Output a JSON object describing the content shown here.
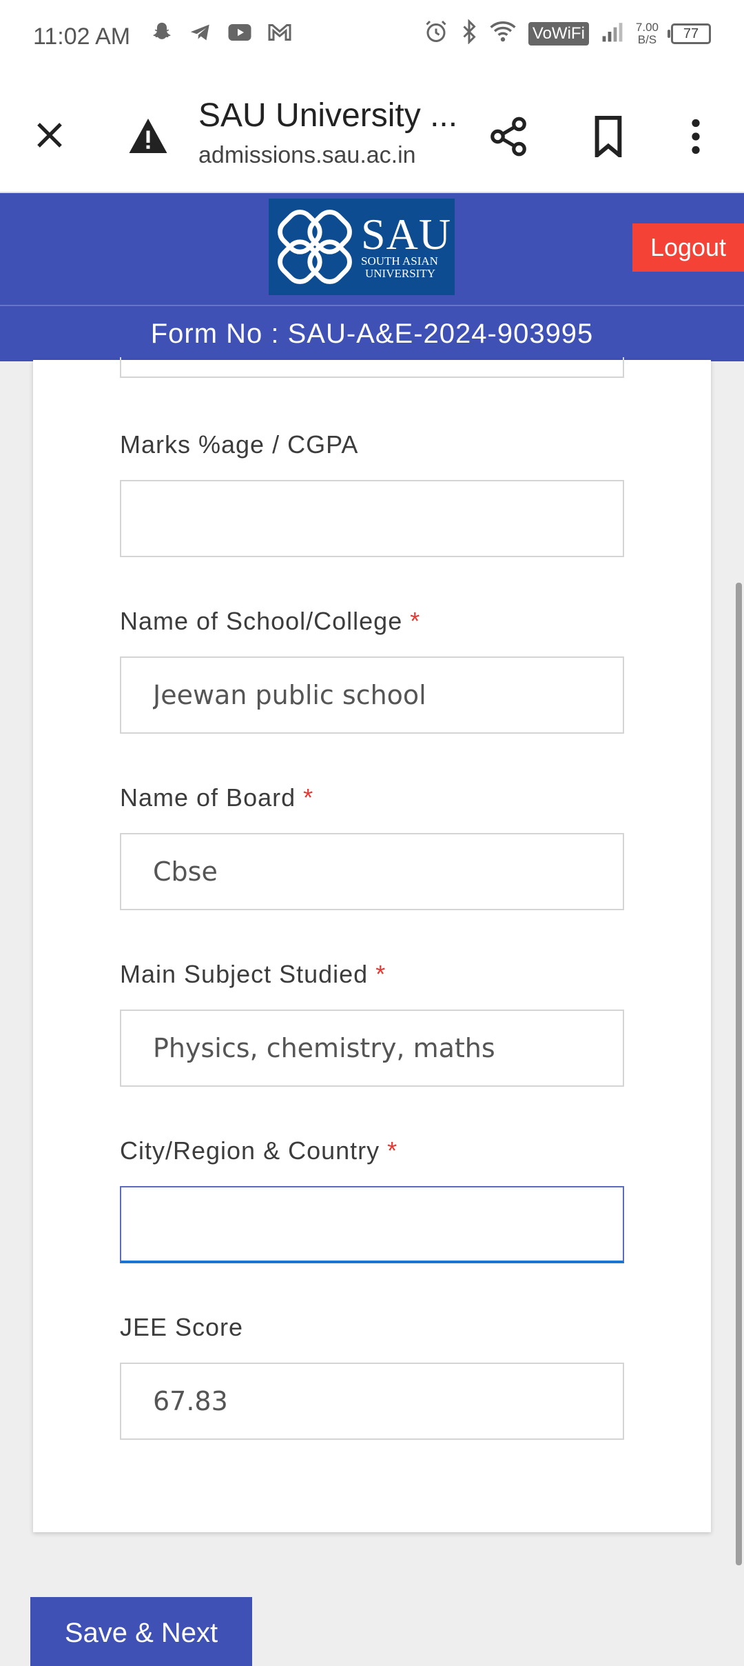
{
  "status_bar": {
    "time": "11:02 AM",
    "left_icons": [
      "snapchat-icon",
      "telegram-icon",
      "youtube-icon",
      "gmail-icon"
    ],
    "right_icons": [
      "alarm-icon",
      "bluetooth-icon",
      "wifi-icon",
      "vowifi-badge",
      "signal-icon",
      "net-speed",
      "battery-icon"
    ],
    "vowifi": "VoWiFi",
    "net_speed_value": "7.00",
    "net_speed_unit": "B/S",
    "battery_level": "77"
  },
  "browser": {
    "title": "SAU University ...",
    "url": "admissions.sau.ac.in"
  },
  "header": {
    "logo_text": "SAU",
    "logo_sub_line1": "SOUTH ASIAN",
    "logo_sub_line2": "UNIVERSITY",
    "logout_label": "Logout",
    "form_no": "Form No : SAU-A&E-2024-903995"
  },
  "form": {
    "required_marker": "*",
    "fields": [
      {
        "label": "Marks %age / CGPA",
        "value": "",
        "required": false
      },
      {
        "label": "Name of School/College",
        "value": "Jeewan public school",
        "required": true
      },
      {
        "label": "Name of Board",
        "value": "Cbse",
        "required": true
      },
      {
        "label": "Main Subject Studied",
        "value": "Physics, chemistry, maths",
        "required": true
      },
      {
        "label": "City/Region & Country",
        "value": "",
        "required": true
      },
      {
        "label": "JEE Score",
        "value": "67.83",
        "required": false
      }
    ],
    "save_label": "Save & Next"
  },
  "colors": {
    "header_blue": "#3f51b5",
    "logo_blue": "#0d4c91",
    "logout_red": "#f44336",
    "required_red": "#e53935",
    "focus_blue": "#1976d2"
  }
}
